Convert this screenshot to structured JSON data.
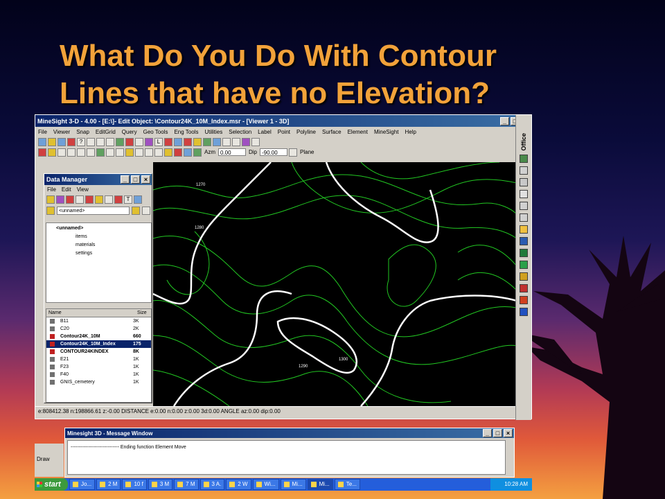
{
  "slide": {
    "title_line1": "What Do You Do With Contour",
    "title_line2": "Lines that have no Elevation?"
  },
  "app": {
    "window_title": "MineSight 3-D - 4.00 - [E:\\]- Edit Object: \\Contour24K_10M_Index.msr - [Viewer 1 - 3D]",
    "menu": [
      "File",
      "Viewer",
      "Snap",
      "EditGrid",
      "Query",
      "Geo Tools",
      "Eng Tools",
      "Utilities",
      "Selection",
      "Label",
      "Point",
      "Polyline",
      "Surface",
      "Element",
      "MineSight",
      "Help"
    ],
    "azm_label": "Azm",
    "azm_value": "0.00",
    "dip_label": "Dip",
    "dip_value": "-90.00",
    "plane_label": "Plane",
    "office_label": "Office",
    "status_text": "e:808412.38  n:198866.61  z:-0.00  DISTANCE  e:0.00  n:0.00  z:0.00  3d:0.00  ANGLE  az:0.00  dip:0.00",
    "contour_labels": [
      "1270",
      "1280",
      "1290",
      "1300"
    ]
  },
  "data_manager": {
    "title": "Data Manager",
    "menu": [
      "File",
      "Edit",
      "View"
    ],
    "address": "<unnamed>",
    "tree": [
      {
        "label": "<unnamed>"
      },
      {
        "label": "items"
      },
      {
        "label": "materials"
      },
      {
        "label": "settings"
      }
    ],
    "columns": [
      "Name",
      "Size"
    ],
    "rows": [
      {
        "name": "B11",
        "size": "3K"
      },
      {
        "name": "C20",
        "size": "2K"
      },
      {
        "name": "Contour24K_10M",
        "size": "660"
      },
      {
        "name": "Contour24K_10M_Index",
        "size": "175"
      },
      {
        "name": "CONTOUR24KINDEX",
        "size": "8K"
      },
      {
        "name": "E21",
        "size": "1K"
      },
      {
        "name": "F23",
        "size": "1K"
      },
      {
        "name": "F40",
        "size": "1K"
      },
      {
        "name": "GNIS_cemetery",
        "size": "1K"
      }
    ]
  },
  "message_window": {
    "title": "Minesight 3D - Message Window",
    "text": "------------------------------  Ending function Element Move"
  },
  "draw_label": "Draw",
  "taskbar": {
    "start_label": "start",
    "tasks": [
      "Jo...",
      "2 M",
      "10 f",
      "3 M",
      "7 M",
      "3 A.",
      "2 W",
      "Wi...",
      "Mi...",
      "Mi...",
      "Te..."
    ],
    "clock": "10:28 AM"
  },
  "colors": {
    "title": "#f2a23a",
    "contour_minor": "#22c822",
    "contour_index": "#ffffff",
    "titlebar": "#0a246a"
  }
}
